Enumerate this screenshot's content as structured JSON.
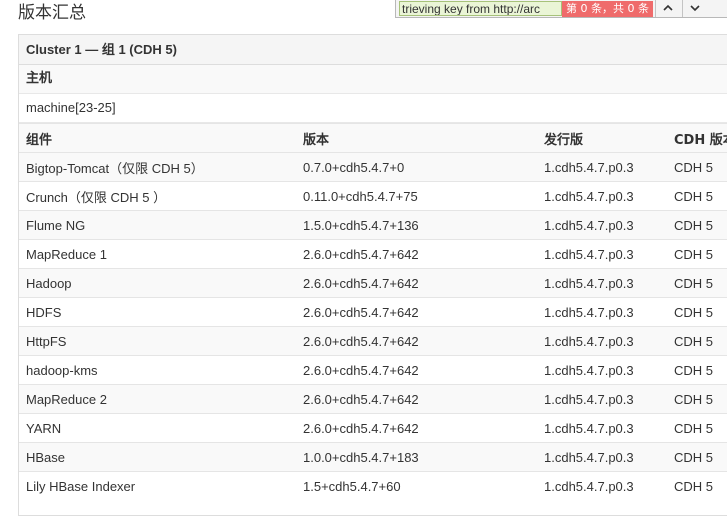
{
  "page_title": "版本汇总",
  "find_bar": {
    "query": "trieving key from http://arc",
    "match_count": "第 0 条，共 0 条"
  },
  "panel": {
    "header": "Cluster 1 — 组 1 (CDH 5)",
    "hosts_label": "主机",
    "hosts_value": "machine[23-25]"
  },
  "table": {
    "columns": [
      "组件",
      "版本",
      "发行版",
      "CDH 版本"
    ],
    "rows": [
      [
        "Bigtop-Tomcat（仅限 CDH 5）",
        "0.7.0+cdh5.4.7+0",
        "1.cdh5.4.7.p0.3",
        "CDH 5"
      ],
      [
        "Crunch（仅限 CDH 5 ）",
        "0.11.0+cdh5.4.7+75",
        "1.cdh5.4.7.p0.3",
        "CDH 5"
      ],
      [
        "Flume NG",
        "1.5.0+cdh5.4.7+136",
        "1.cdh5.4.7.p0.3",
        "CDH 5"
      ],
      [
        "MapReduce 1",
        "2.6.0+cdh5.4.7+642",
        "1.cdh5.4.7.p0.3",
        "CDH 5"
      ],
      [
        "Hadoop",
        "2.6.0+cdh5.4.7+642",
        "1.cdh5.4.7.p0.3",
        "CDH 5"
      ],
      [
        "HDFS",
        "2.6.0+cdh5.4.7+642",
        "1.cdh5.4.7.p0.3",
        "CDH 5"
      ],
      [
        "HttpFS",
        "2.6.0+cdh5.4.7+642",
        "1.cdh5.4.7.p0.3",
        "CDH 5"
      ],
      [
        "hadoop-kms",
        "2.6.0+cdh5.4.7+642",
        "1.cdh5.4.7.p0.3",
        "CDH 5"
      ],
      [
        "MapReduce 2",
        "2.6.0+cdh5.4.7+642",
        "1.cdh5.4.7.p0.3",
        "CDH 5"
      ],
      [
        "YARN",
        "2.6.0+cdh5.4.7+642",
        "1.cdh5.4.7.p0.3",
        "CDH 5"
      ],
      [
        "HBase",
        "1.0.0+cdh5.4.7+183",
        "1.cdh5.4.7.p0.3",
        "CDH 5"
      ],
      [
        "Lily HBase Indexer",
        "1.5+cdh5.4.7+60",
        "1.cdh5.4.7.p0.3",
        "CDH 5"
      ]
    ]
  }
}
